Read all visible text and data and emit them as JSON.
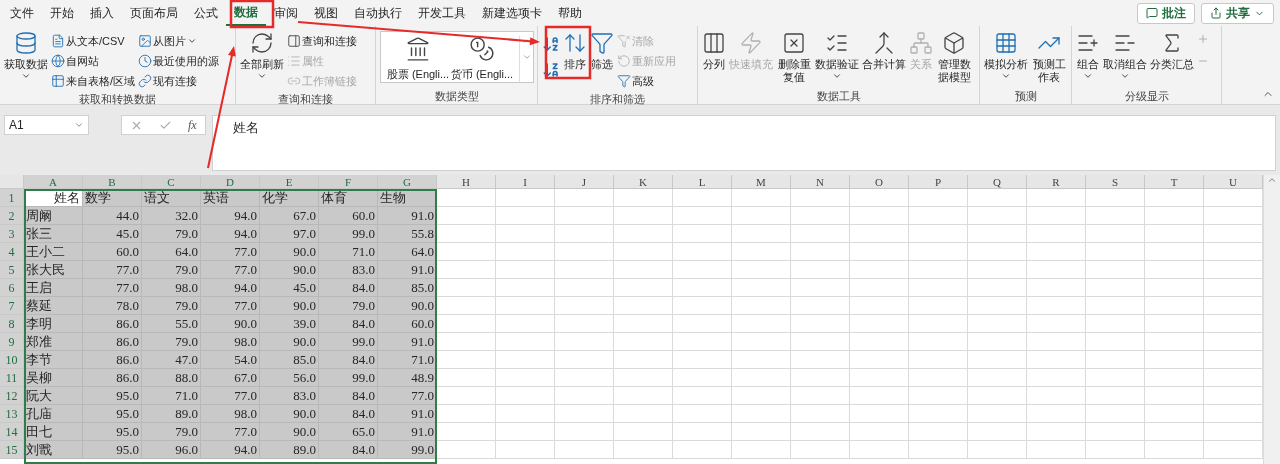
{
  "menu_tabs": [
    {
      "label": "文件",
      "selected": false
    },
    {
      "label": "开始",
      "selected": false
    },
    {
      "label": "插入",
      "selected": false
    },
    {
      "label": "页面布局",
      "selected": false
    },
    {
      "label": "公式",
      "selected": false
    },
    {
      "label": "数据",
      "selected": true
    },
    {
      "label": "审阅",
      "selected": false
    },
    {
      "label": "视图",
      "selected": false
    },
    {
      "label": "自动执行",
      "selected": false
    },
    {
      "label": "开发工具",
      "selected": false
    },
    {
      "label": "新建选项卡",
      "selected": false
    },
    {
      "label": "帮助",
      "selected": false
    }
  ],
  "top_buttons": [
    {
      "label": "批注",
      "kind": "comment"
    },
    {
      "label": "共享",
      "kind": "share"
    }
  ],
  "ribbon_groups": [
    {
      "title": "获取和转换数据",
      "columns": [
        [
          {
            "label": "获取数据",
            "kind": "large",
            "disabled": false,
            "dropdown": true
          }
        ],
        [
          {
            "label": "从文本/CSV",
            "kind": "small",
            "disabled": false,
            "dropdown": false
          },
          {
            "label": "自网站",
            "kind": "small",
            "disabled": false,
            "dropdown": false
          },
          {
            "label": "来自表格/区域",
            "kind": "small",
            "disabled": false,
            "dropdown": false
          }
        ],
        [
          {
            "label": "从图片",
            "kind": "small",
            "disabled": false,
            "dropdown": true
          },
          {
            "label": "最近使用的源",
            "kind": "small",
            "disabled": false,
            "dropdown": false
          },
          {
            "label": "现有连接",
            "kind": "small",
            "disabled": false,
            "dropdown": false
          }
        ]
      ]
    },
    {
      "title": "查询和连接",
      "columns": [
        [
          {
            "label": "全部刷新",
            "kind": "large",
            "disabled": false,
            "dropdown": true
          }
        ],
        [
          {
            "label": "查询和连接",
            "kind": "small",
            "disabled": false,
            "dropdown": false
          },
          {
            "label": "属性",
            "kind": "small",
            "disabled": true,
            "dropdown": false
          },
          {
            "label": "工作簿链接",
            "kind": "small",
            "disabled": true,
            "dropdown": false
          }
        ]
      ]
    },
    {
      "title": "数据类型",
      "columns": [
        [
          {
            "label": "股票 (Engli...",
            "kind": "gallery"
          }
        ],
        [
          {
            "label": "货币 (Engli...",
            "kind": "gallery"
          }
        ]
      ]
    },
    {
      "title": "排序和筛选",
      "columns": [
        [
          {
            "label": "排序",
            "kind": "large",
            "disabled": false,
            "dropdown": false
          }
        ],
        [
          {
            "label": "筛选",
            "kind": "large",
            "disabled": false,
            "dropdown": false
          }
        ],
        [
          {
            "label": "清除",
            "kind": "small",
            "disabled": true,
            "dropdown": false
          },
          {
            "label": "重新应用",
            "kind": "small",
            "disabled": true,
            "dropdown": false
          },
          {
            "label": "高级",
            "kind": "small",
            "disabled": false,
            "dropdown": false
          }
        ]
      ]
    },
    {
      "title": "数据工具",
      "columns": [
        [
          {
            "label": "分列",
            "kind": "large",
            "disabled": false,
            "dropdown": false
          }
        ],
        [
          {
            "label": "快速填充",
            "kind": "large",
            "disabled": true,
            "dropdown": false
          }
        ],
        [
          {
            "label": "删除重复值",
            "kind": "large",
            "disabled": false,
            "dropdown": false
          }
        ],
        [
          {
            "label": "数据验证",
            "kind": "large",
            "disabled": false,
            "dropdown": true
          }
        ],
        [
          {
            "label": "合并计算",
            "kind": "large",
            "disabled": false,
            "dropdown": false
          }
        ],
        [
          {
            "label": "关系",
            "kind": "large",
            "disabled": true,
            "dropdown": false
          }
        ],
        [
          {
            "label": "管理数据模型",
            "kind": "large",
            "disabled": false,
            "dropdown": false
          }
        ]
      ]
    },
    {
      "title": "预测",
      "columns": [
        [
          {
            "label": "模拟分析",
            "kind": "large",
            "disabled": false,
            "dropdown": true
          }
        ],
        [
          {
            "label": "预测工作表",
            "kind": "large",
            "disabled": false,
            "dropdown": false
          }
        ]
      ]
    },
    {
      "title": "分级显示",
      "columns": [
        [
          {
            "label": "组合",
            "kind": "large",
            "disabled": false,
            "dropdown": true
          }
        ],
        [
          {
            "label": "取消组合",
            "kind": "large",
            "disabled": false,
            "dropdown": true
          }
        ],
        [
          {
            "label": "分类汇总",
            "kind": "large",
            "disabled": false,
            "dropdown": false
          }
        ]
      ]
    }
  ],
  "name_box": "A1",
  "function_label": "fx",
  "formula": "姓名",
  "grid": {
    "columns": [
      {
        "label": "A",
        "selected": true
      },
      {
        "label": "B",
        "selected": true
      },
      {
        "label": "C",
        "selected": true
      },
      {
        "label": "D",
        "selected": true
      },
      {
        "label": "E",
        "selected": true
      },
      {
        "label": "F",
        "selected": true
      },
      {
        "label": "G",
        "selected": true
      },
      {
        "label": "H",
        "selected": false
      },
      {
        "label": "I",
        "selected": false
      },
      {
        "label": "J",
        "selected": false
      },
      {
        "label": "K",
        "selected": false
      },
      {
        "label": "L",
        "selected": false
      },
      {
        "label": "M",
        "selected": false
      },
      {
        "label": "N",
        "selected": false
      },
      {
        "label": "O",
        "selected": false
      },
      {
        "label": "P",
        "selected": false
      },
      {
        "label": "Q",
        "selected": false
      },
      {
        "label": "R",
        "selected": false
      },
      {
        "label": "S",
        "selected": false
      },
      {
        "label": "T",
        "selected": false
      },
      {
        "label": "U",
        "selected": false
      }
    ],
    "rows": [
      {
        "number": "1",
        "selected": true,
        "active_first": true,
        "cells": [
          "姓名",
          "数学",
          "语文",
          "英语",
          "化学",
          "体育",
          "生物"
        ]
      },
      {
        "number": "2",
        "selected": true,
        "active_first": false,
        "cells": [
          "周阚",
          "44.0",
          "32.0",
          "94.0",
          "67.0",
          "60.0",
          "91.0"
        ]
      },
      {
        "number": "3",
        "selected": true,
        "active_first": false,
        "cells": [
          "张三",
          "45.0",
          "79.0",
          "94.0",
          "97.0",
          "99.0",
          "55.8"
        ]
      },
      {
        "number": "4",
        "selected": true,
        "active_first": false,
        "cells": [
          "王小二",
          "60.0",
          "64.0",
          "77.0",
          "90.0",
          "71.0",
          "64.0"
        ]
      },
      {
        "number": "5",
        "selected": true,
        "active_first": false,
        "cells": [
          "张大民",
          "77.0",
          "79.0",
          "77.0",
          "90.0",
          "83.0",
          "91.0"
        ]
      },
      {
        "number": "6",
        "selected": true,
        "active_first": false,
        "cells": [
          "王启",
          "77.0",
          "98.0",
          "94.0",
          "45.0",
          "84.0",
          "85.0"
        ]
      },
      {
        "number": "7",
        "selected": true,
        "active_first": false,
        "cells": [
          "蔡延",
          "78.0",
          "79.0",
          "77.0",
          "90.0",
          "79.0",
          "90.0"
        ]
      },
      {
        "number": "8",
        "selected": true,
        "active_first": false,
        "cells": [
          "李明",
          "86.0",
          "55.0",
          "90.0",
          "39.0",
          "84.0",
          "60.0"
        ]
      },
      {
        "number": "9",
        "selected": true,
        "active_first": false,
        "cells": [
          "郑准",
          "86.0",
          "79.0",
          "98.0",
          "90.0",
          "99.0",
          "91.0"
        ]
      },
      {
        "number": "10",
        "selected": true,
        "active_first": false,
        "cells": [
          "李节",
          "86.0",
          "47.0",
          "54.0",
          "85.0",
          "84.0",
          "71.0"
        ]
      },
      {
        "number": "11",
        "selected": true,
        "active_first": false,
        "cells": [
          "吴柳",
          "86.0",
          "88.0",
          "67.0",
          "56.0",
          "99.0",
          "48.9"
        ]
      },
      {
        "number": "12",
        "selected": true,
        "active_first": false,
        "cells": [
          "阮大",
          "95.0",
          "71.0",
          "77.0",
          "83.0",
          "84.0",
          "77.0"
        ]
      },
      {
        "number": "13",
        "selected": true,
        "active_first": false,
        "cells": [
          "孔庙",
          "95.0",
          "89.0",
          "98.0",
          "90.0",
          "84.0",
          "91.0"
        ]
      },
      {
        "number": "14",
        "selected": true,
        "active_first": false,
        "cells": [
          "田七",
          "95.0",
          "79.0",
          "77.0",
          "90.0",
          "65.0",
          "91.0"
        ]
      },
      {
        "number": "15",
        "selected": true,
        "active_first": false,
        "cells": [
          "刘戬",
          "95.0",
          "96.0",
          "94.0",
          "89.0",
          "84.0",
          "99.0"
        ]
      }
    ]
  }
}
